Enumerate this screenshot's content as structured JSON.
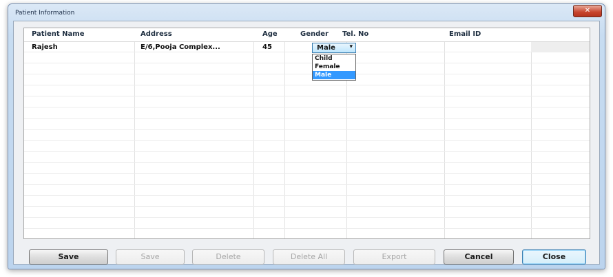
{
  "window": {
    "title": "Patient Information"
  },
  "grid": {
    "columns": [
      "Patient Name",
      "Address",
      "Age",
      "Gender",
      "Tel. No",
      "Email ID"
    ],
    "rows": [
      {
        "patient_name": "Rajesh",
        "address": "E/6,Pooja Complex...",
        "age": "45",
        "gender": "Male",
        "tel": "",
        "email": ""
      }
    ]
  },
  "gender_dropdown": {
    "selected": "Male",
    "options": [
      "Child",
      "Female",
      "Male"
    ],
    "highlighted": "Male"
  },
  "buttons": {
    "save1": "Save",
    "save2": "Save",
    "delete": "Delete",
    "delete_all": "Delete All",
    "export": "Export",
    "cancel": "Cancel",
    "close": "Close"
  },
  "colors": {
    "selection": "#3399ff",
    "close_button": "#c7442d"
  }
}
